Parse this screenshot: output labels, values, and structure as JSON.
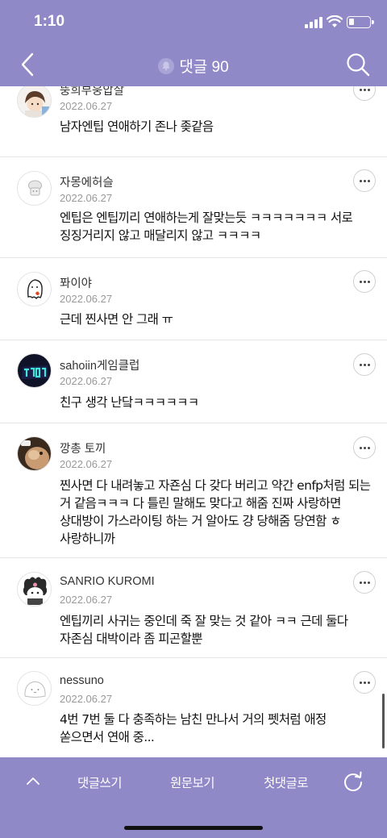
{
  "status": {
    "time": "1:10"
  },
  "header": {
    "title": "댓글 90"
  },
  "comments": [
    {
      "author": "뚱희부웅압살",
      "date": "2022.06.27",
      "text": "남자엔팁 연애하기 존나 좆같음"
    },
    {
      "author": "자몽에허슬",
      "date": "2022.06.27",
      "text": "엔팁은 엔팁끼리 연애하는게 잘맞는듯 ㅋㅋㅋㅋㅋㅋㅋ 서로 징징거리지 않고 매달리지 않고 ㅋㅋㅋㅋ"
    },
    {
      "author": "퐈이야",
      "date": "2022.06.27",
      "text": "근데 찐사면 안 그래 ㅠ"
    },
    {
      "author": "sahoiin게임클럽",
      "date": "2022.06.27",
      "text": "친구 생각 난닼ㅋㅋㅋㅋㅋㅋ"
    },
    {
      "author": "깡총 토끼",
      "date": "2022.06.27",
      "text": "찐사면 다 내려놓고 자죤심 다 갖다 버리고 약간 enfp처럼 되는 거 같음ㅋㅋㅋ 다 틀린 말해도 맞다고 해줌 진짜 사랑하면 상대방이 가스라이팅 하는 거 알아도 걍 당해줌 당연함 ㅎ 사랑하니까"
    },
    {
      "author": "SANRIO KUROMI",
      "date": "2022.06.27",
      "text": "엔팁끼리 사귀는 중인데 죽 잘 맞는 것 같아 ㅋㅋ 근데 둘다 자존심 대박이라 좀 피곤할뿐"
    },
    {
      "author": "nessuno",
      "date": "2022.06.27",
      "text": "4번 7번 둘 다 충족하는 남친 만나서 거의 펫처럼 애정 쏟으면서 연애 중..."
    }
  ],
  "avatar_icons": [
    "boy-avatar-icon",
    "mushroom-avatar-icon",
    "ghost-avatar-icon",
    "game-club-avatar-icon",
    "photo-avatar-icon",
    "kuromi-avatar-icon",
    "blob-avatar-icon"
  ],
  "bottom_bar": {
    "write": "댓글쓰기",
    "original": "원문보기",
    "first": "첫댓글로"
  },
  "colors": {
    "theme": "#8f89c8",
    "text": "#111111",
    "muted": "#999999"
  }
}
